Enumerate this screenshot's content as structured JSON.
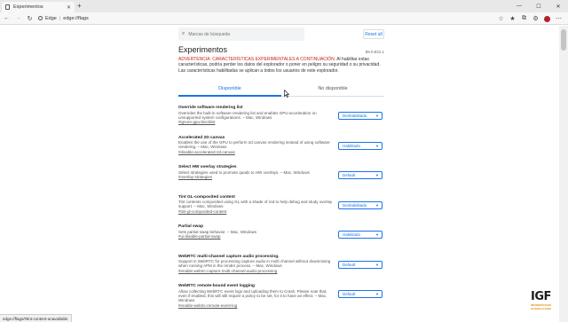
{
  "browser": {
    "tab_title": "Experimentos",
    "address_prefix": "Edge",
    "address_path": "edge://flags",
    "new_tab_label": "+",
    "avatar_color": "#b4202a"
  },
  "search": {
    "placeholder": "Marcas de búsqueda",
    "reset_label": "Reset all"
  },
  "header": {
    "title": "Experimentos",
    "version": "89.0.831.1",
    "warning_strong": "ADVERTENCIA: CARACTERÍSTICAS EXPERIMENTALES A CONTINUACIÓN.",
    "warning_text": "Al habilitar estas características, podría perder los datos del explorador o poner en peligro su seguridad o su privacidad. Las características habilitadas se aplican a todos los usuarios de este explorador."
  },
  "tabs": [
    {
      "label": "Disponible",
      "active": true
    },
    {
      "label": "No disponible",
      "active": false
    }
  ],
  "experiments": [
    {
      "name": "Override software rendering list",
      "description": "Overrides the built-in software rendering list and enables GPU-acceleration on unsupported system configurations. – Mac, Windows",
      "link": "#ignore-gpu-blocklist",
      "value": "Deshabilitado"
    },
    {
      "name": "Accelerated 2D canvas",
      "description": "Enables the use of the GPU to perform 2d canvas rendering instead of using software rendering. – Mac, Windows",
      "link": "#disable-accelerated-2d-canvas",
      "value": "Habilitado"
    },
    {
      "name": "Select HW overlay strategies",
      "description": "Select strategies used to promote quads to HW overlays. – Mac, Windows",
      "link": "#overlay-strategies",
      "value": "Default"
    },
    {
      "name": "Tint GL-composited content",
      "description": "Tint contents composited using GL with a shade of red to help debug and study overlay support. – Mac, Windows",
      "link": "#tint-gl-composited-content",
      "value": "Deshabilitado"
    },
    {
      "name": "Partial swap",
      "description": "Sets partial swap behavior. – Mac, Windows",
      "link": "#ui-disable-partial-swap",
      "value": "Habilitado"
    },
    {
      "name": "WebRTC multi-channel capture audio processing.",
      "description": "Support in WebRTC for processing capture audio in multi channel without downmixing when running APM in the render process. – Mac, Windows",
      "link": "#enable-webrtc-capture-multi-channel-audio-processing",
      "value": "Default"
    },
    {
      "name": "WebRTC remote-bound event logging",
      "description": "Allow collecting WebRTC event logs and uploading them to Crash. Please note that, even if enabled, this will still require a policy to be set, for it to have an effect. – Mac, Windows",
      "link": "#enable-webrtc-remote-event-log",
      "value": "Default"
    }
  ],
  "status_bar": {
    "text": "edge://flags/#tint-content-unavailable"
  },
  "logo": {
    "mark": "IGF",
    "sub": "INFORMÁTICOS GUADALAJARA"
  }
}
